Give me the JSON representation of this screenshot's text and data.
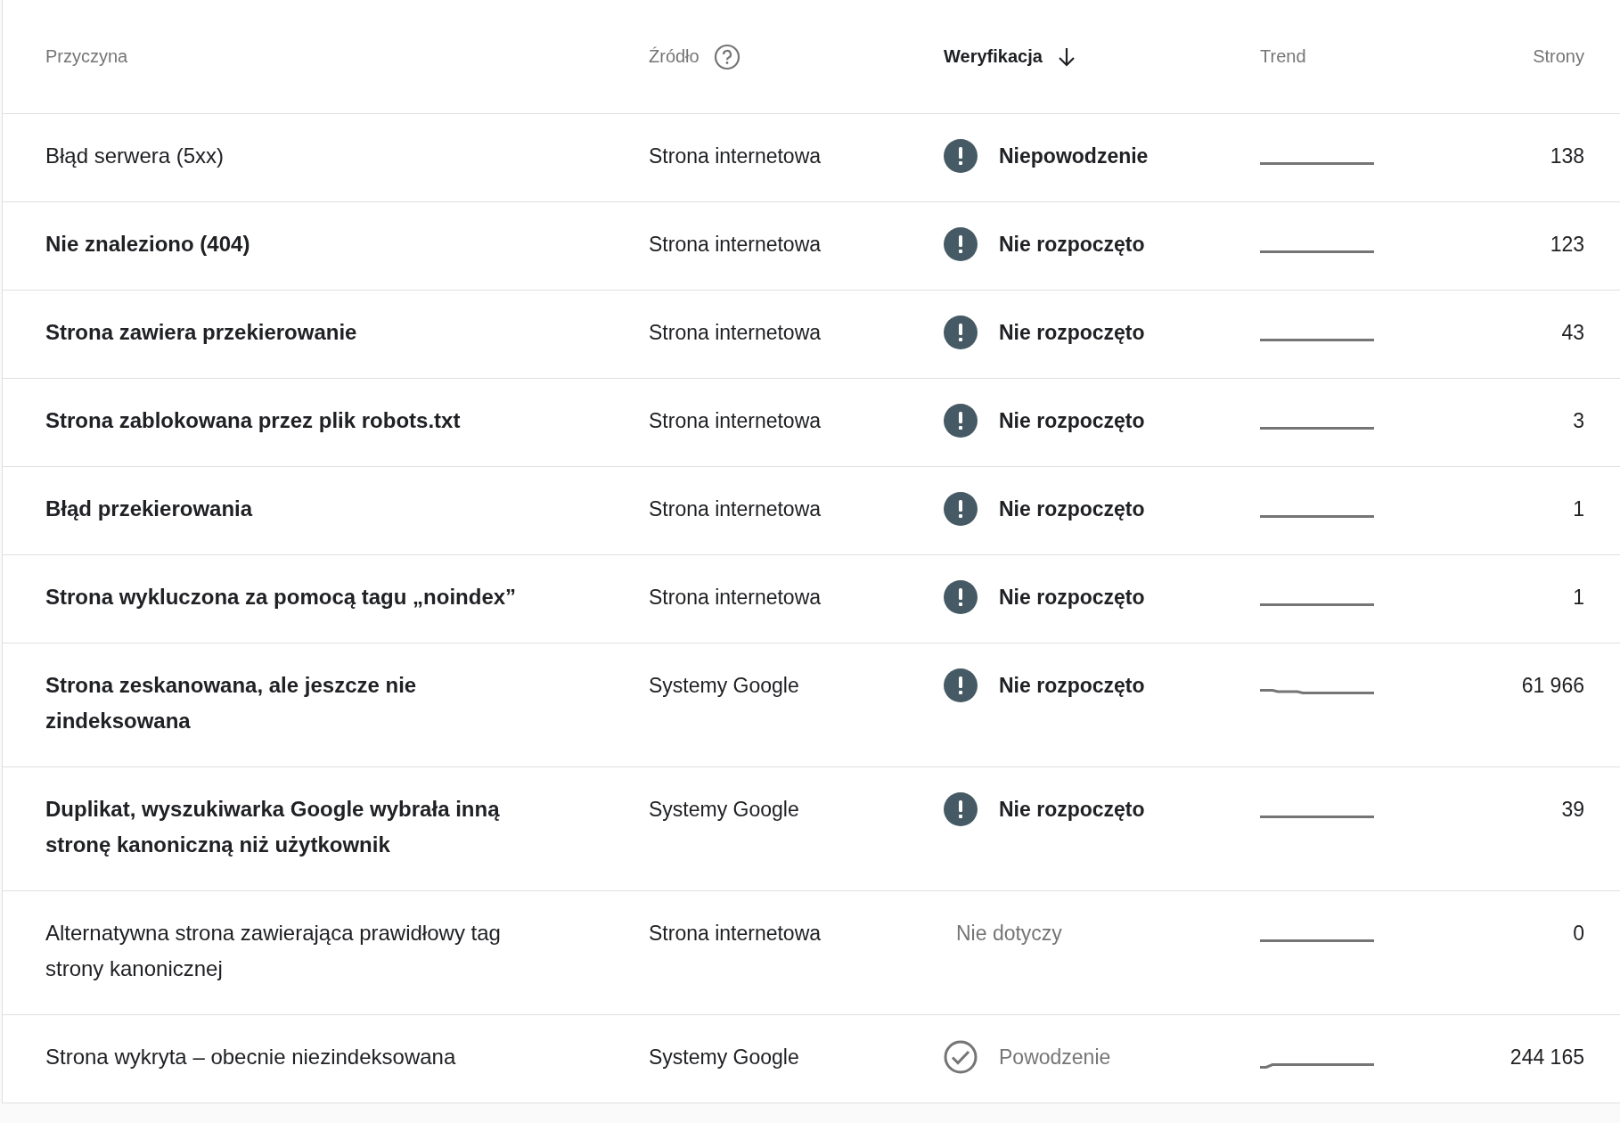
{
  "table": {
    "columns": [
      {
        "label": "Przyczyna",
        "active": false,
        "help": false,
        "sorted": false
      },
      {
        "label": "Źródło",
        "active": false,
        "help": true,
        "sorted": false
      },
      {
        "label": "Weryfikacja",
        "active": true,
        "help": false,
        "sorted": true
      },
      {
        "label": "Trend",
        "active": false,
        "help": false,
        "sorted": false
      },
      {
        "label": "Strony",
        "active": false,
        "help": false,
        "sorted": false
      }
    ],
    "rows": [
      {
        "reason": "Błąd serwera (5xx)",
        "highlighted": false,
        "source": "Strona internetowa",
        "verification": {
          "kind": "failed",
          "label": "Niepowodzenie"
        },
        "trend": {
          "kind": "flat"
        },
        "pages": "138"
      },
      {
        "reason": "Nie znaleziono (404)",
        "highlighted": true,
        "source": "Strona internetowa",
        "verification": {
          "kind": "not_started",
          "label": "Nie rozpoczęto"
        },
        "trend": {
          "kind": "flat"
        },
        "pages": "123"
      },
      {
        "reason": "Strona zawiera przekierowanie",
        "highlighted": true,
        "source": "Strona internetowa",
        "verification": {
          "kind": "not_started",
          "label": "Nie rozpoczęto"
        },
        "trend": {
          "kind": "flat"
        },
        "pages": "43"
      },
      {
        "reason": "Strona zablokowana przez plik robots.txt",
        "highlighted": true,
        "source": "Strona internetowa",
        "verification": {
          "kind": "not_started",
          "label": "Nie rozpoczęto"
        },
        "trend": {
          "kind": "flat"
        },
        "pages": "3"
      },
      {
        "reason": "Błąd przekierowania",
        "highlighted": true,
        "source": "Strona internetowa",
        "verification": {
          "kind": "not_started",
          "label": "Nie rozpoczęto"
        },
        "trend": {
          "kind": "flat"
        },
        "pages": "1"
      },
      {
        "reason": "Strona wykluczona za pomocą tagu „noindex”",
        "highlighted": true,
        "source": "Strona internetowa",
        "verification": {
          "kind": "not_started",
          "label": "Nie rozpoczęto"
        },
        "trend": {
          "kind": "flat"
        },
        "pages": "1"
      },
      {
        "reason": "Strona zeskanowana, ale jeszcze nie zindeksowana",
        "highlighted": true,
        "source": "Systemy Google",
        "verification": {
          "kind": "not_started",
          "label": "Nie rozpoczęto"
        },
        "trend": {
          "kind": "step_down"
        },
        "pages": "61 966"
      },
      {
        "reason": "Duplikat, wyszukiwarka Google wybrała inną stronę kanoniczną niż użytkownik",
        "highlighted": true,
        "source": "Systemy Google",
        "verification": {
          "kind": "not_started",
          "label": "Nie rozpoczęto"
        },
        "trend": {
          "kind": "flat"
        },
        "pages": "39"
      },
      {
        "reason": "Alternatywna strona zawierająca prawidłowy tag strony kanonicznej",
        "highlighted": false,
        "source": "Strona internetowa",
        "verification": {
          "kind": "not_applicable",
          "label": "Nie dotyczy"
        },
        "trend": {
          "kind": "flat"
        },
        "pages": "0"
      },
      {
        "reason": "Strona wykryta – obecnie niezindeksowana",
        "highlighted": false,
        "source": "Systemy Google",
        "verification": {
          "kind": "passed",
          "label": "Powodzenie"
        },
        "trend": {
          "kind": "step_up"
        },
        "pages": "244 165"
      }
    ]
  }
}
